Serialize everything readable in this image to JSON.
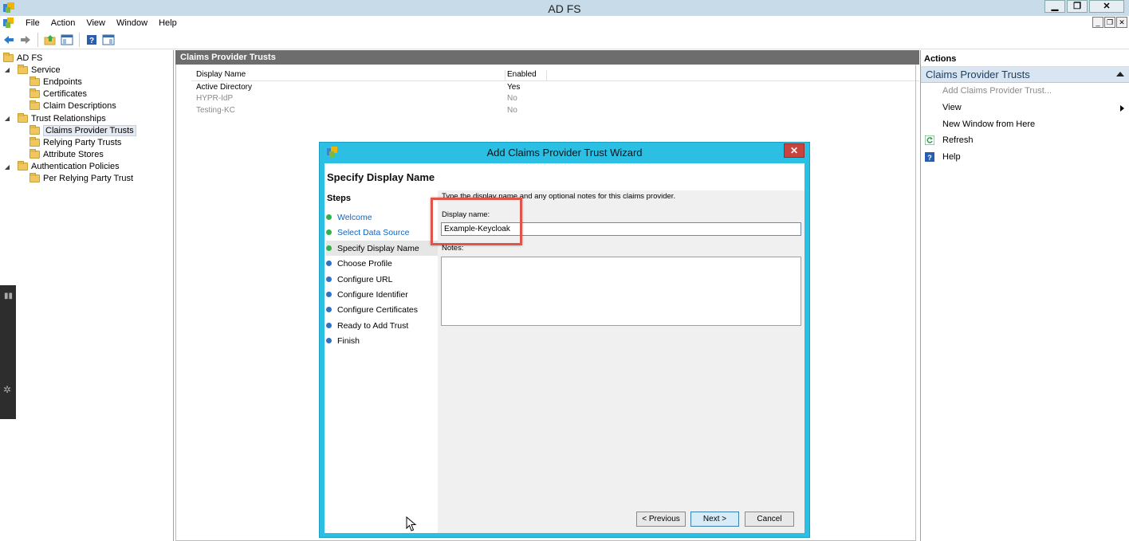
{
  "window": {
    "title": "AD FS",
    "controls": {
      "minimize": "▁",
      "restore": "❐",
      "close": "✕"
    },
    "mdi_controls": {
      "minimize": "_",
      "restore": "❐",
      "close": "✕"
    }
  },
  "menubar": {
    "items": [
      "File",
      "Action",
      "View",
      "Window",
      "Help"
    ]
  },
  "toolbar": {
    "icons": [
      "back-arrow-icon",
      "forward-arrow-icon",
      "up-folder-icon",
      "show-hide-console-tree-icon",
      "help-icon",
      "show-hide-action-pane-icon"
    ]
  },
  "tree": {
    "root": "AD FS",
    "service": "Service",
    "endpoints": "Endpoints",
    "certificates": "Certificates",
    "claim_descriptions": "Claim Descriptions",
    "trust_relationships": "Trust Relationships",
    "claims_provider_trusts": "Claims Provider Trusts",
    "relying_party_trusts": "Relying Party Trusts",
    "attribute_stores": "Attribute Stores",
    "authentication_policies": "Authentication Policies",
    "per_relying_party_trust": "Per Relying Party Trust"
  },
  "center": {
    "header": "Claims Provider Trusts",
    "columns": [
      "Display Name",
      "Enabled"
    ],
    "rows": [
      {
        "name": "Active Directory",
        "enabled": "Yes"
      },
      {
        "name": "HYPR-IdP",
        "enabled": "No"
      },
      {
        "name": "Testing-KC",
        "enabled": "No"
      }
    ]
  },
  "actions": {
    "header": "Actions",
    "section": "Claims Provider Trusts",
    "items": {
      "add": "Add Claims Provider Trust...",
      "view": "View",
      "new_window": "New Window from Here",
      "refresh": "Refresh",
      "help": "Help"
    }
  },
  "wizard": {
    "title": "Add Claims Provider Trust Wizard",
    "close": "✕",
    "heading": "Specify Display Name",
    "steps_title": "Steps",
    "steps": [
      "Welcome",
      "Select Data Source",
      "Specify Display Name",
      "Choose Profile",
      "Configure URL",
      "Configure Identifier",
      "Configure Certificates",
      "Ready to Add Trust",
      "Finish"
    ],
    "instruction": "Type the display name and any optional notes for this claims provider.",
    "display_name_label": "Display name:",
    "display_name_value": "Example-Keycloak",
    "notes_label": "Notes:",
    "notes_value": "",
    "buttons": {
      "previous": "< Previous",
      "next": "Next >",
      "cancel": "Cancel"
    }
  },
  "colors": {
    "wizard_frame": "#2bbfe4",
    "highlight": "#e0554a",
    "completed_step": "#2fb24a",
    "pending_step": "#2d72c4",
    "link": "#0a66c8"
  }
}
